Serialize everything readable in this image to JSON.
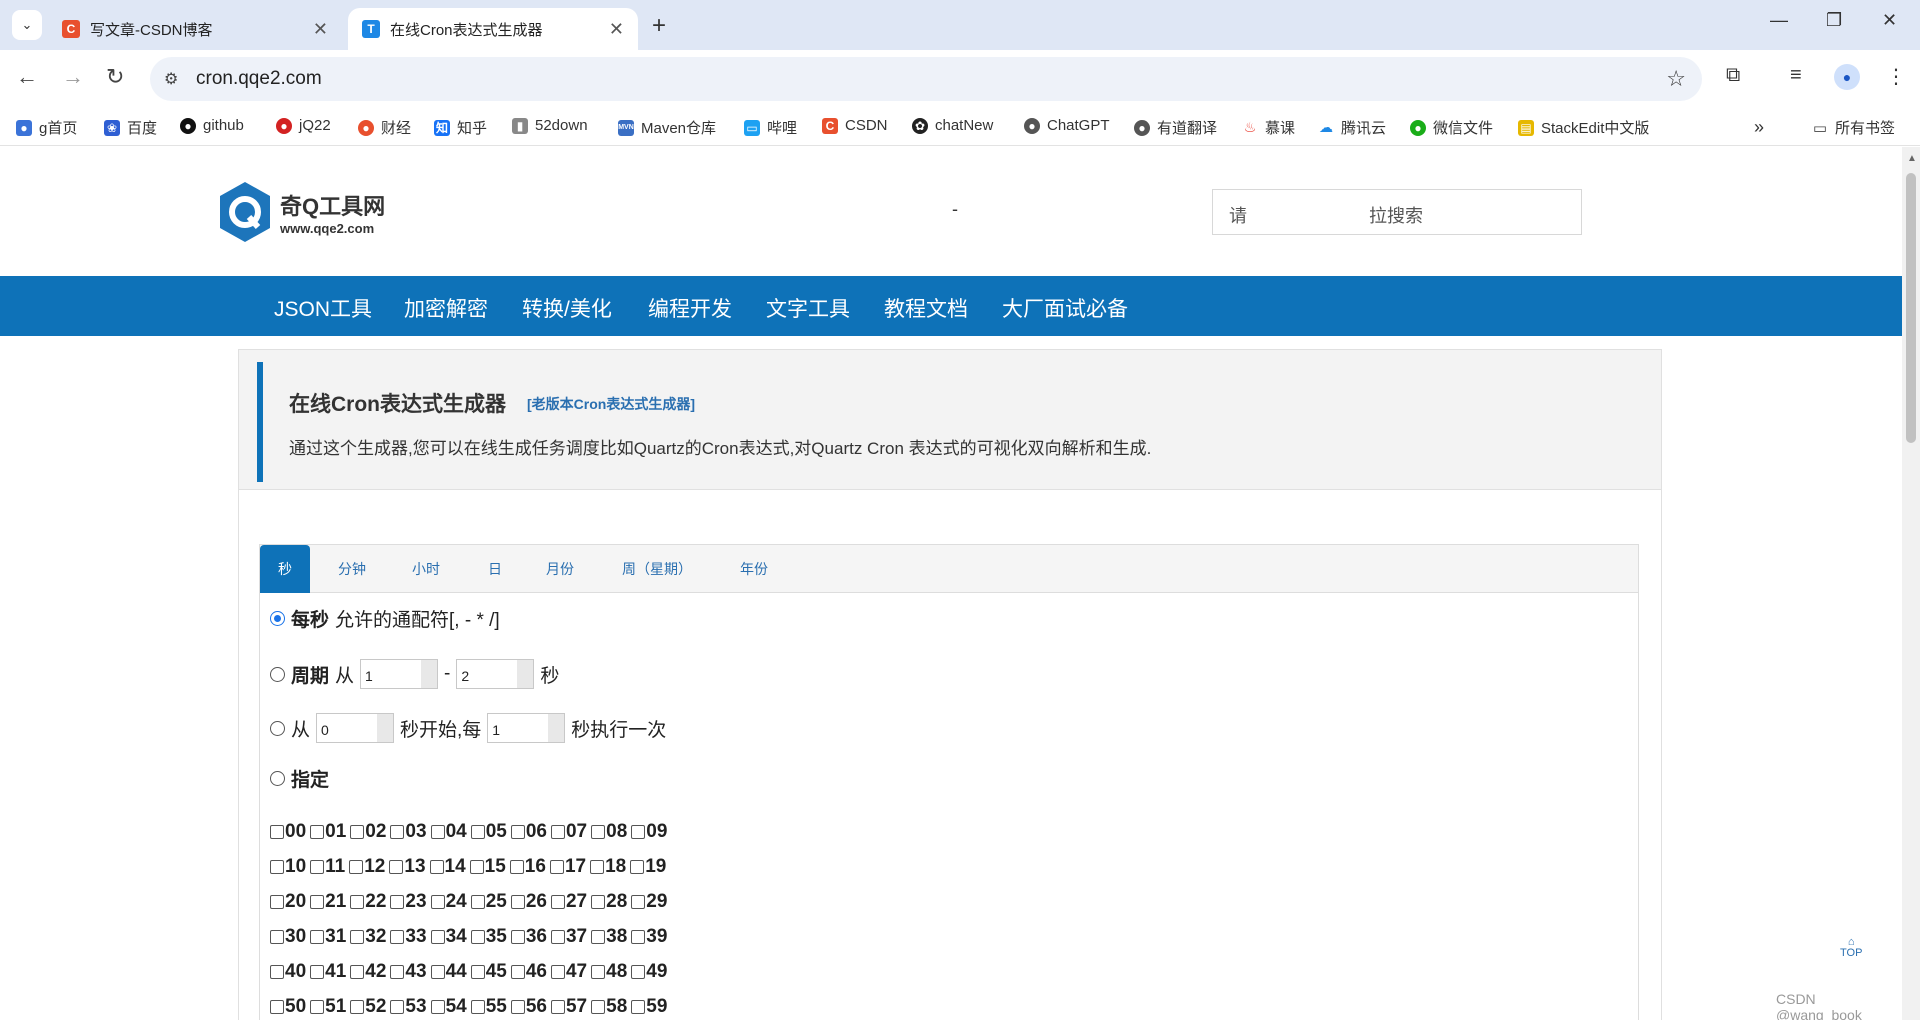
{
  "browser": {
    "tabs": [
      {
        "title": "写文章-CSDN博客",
        "icon": "csdn-icon"
      },
      {
        "title": "在线Cron表达式生成器",
        "icon": "t-icon"
      }
    ],
    "url": "cron.qqe2.com",
    "bookmarks": [
      {
        "label": "g首页",
        "icon": "globe-icon"
      },
      {
        "label": "百度",
        "icon": "baidu-icon"
      },
      {
        "label": "github",
        "icon": "github-icon"
      },
      {
        "label": "jQ22",
        "icon": "jq-icon"
      },
      {
        "label": "财经",
        "icon": "weibo-icon"
      },
      {
        "label": "知乎",
        "icon": "zhihu-icon"
      },
      {
        "label": "52down",
        "icon": "52down-icon"
      },
      {
        "label": "Maven仓库",
        "icon": "mvn-icon"
      },
      {
        "label": "哔哩",
        "icon": "bilibili-icon"
      },
      {
        "label": "CSDN",
        "icon": "csdn-icon"
      },
      {
        "label": "chatNew",
        "icon": "openai-icon"
      },
      {
        "label": "ChatGPT",
        "icon": "globe-icon"
      },
      {
        "label": "有道翻译",
        "icon": "globe-icon"
      },
      {
        "label": "慕课",
        "icon": "fire-icon"
      },
      {
        "label": "腾讯云",
        "icon": "cloud-icon"
      },
      {
        "label": "微信文件",
        "icon": "wechat-icon"
      },
      {
        "label": "StackEdit中文版",
        "icon": "stackedit-icon"
      }
    ],
    "all_bookmarks": "所有书签"
  },
  "site": {
    "logo_name": "奇Q工具网",
    "logo_url": "www.qqe2.com",
    "header_dash": "-",
    "search_left": "请",
    "search_right": "拉搜索",
    "nav": [
      "JSON工具",
      "加密解密",
      "转换/美化",
      "编程开发",
      "文字工具",
      "教程文档",
      "大厂面试必备"
    ]
  },
  "page": {
    "title": "在线Cron表达式生成器",
    "old_link": "[老版本Cron表达式生成器]",
    "description": "通过这个生成器,您可以在线生成任务调度比如Quartz的Cron表达式,对Quartz Cron 表达式的可视化双向解析和生成.",
    "tabs": [
      "秒",
      "分钟",
      "小时",
      "日",
      "月份",
      "周（星期）",
      "年份"
    ],
    "active_tab": "秒",
    "opt_every_label": "每秒",
    "opt_every_text": "允许的通配符[, - * /]",
    "opt_cycle_label": "周期",
    "opt_cycle_from": "从",
    "opt_cycle_sep": "-",
    "opt_cycle_unit": "秒",
    "cycle_from_value": "1",
    "cycle_to_value": "2",
    "opt_start_from": "从",
    "opt_start_mid": "秒开始,每",
    "opt_start_end": "秒执行一次",
    "start_value": "0",
    "step_value": "1",
    "opt_specify_label": "指定",
    "seconds": [
      "00",
      "01",
      "02",
      "03",
      "04",
      "05",
      "06",
      "07",
      "08",
      "09",
      "10",
      "11",
      "12",
      "13",
      "14",
      "15",
      "16",
      "17",
      "18",
      "19",
      "20",
      "21",
      "22",
      "23",
      "24",
      "25",
      "26",
      "27",
      "28",
      "29",
      "30",
      "31",
      "32",
      "33",
      "34",
      "35",
      "36",
      "37",
      "38",
      "39",
      "40",
      "41",
      "42",
      "43",
      "44",
      "45",
      "46",
      "47",
      "48",
      "49",
      "50",
      "51",
      "52",
      "53",
      "54",
      "55",
      "56",
      "57",
      "58",
      "59"
    ],
    "to_top": "TOP",
    "watermark": "CSDN @wang_book"
  }
}
